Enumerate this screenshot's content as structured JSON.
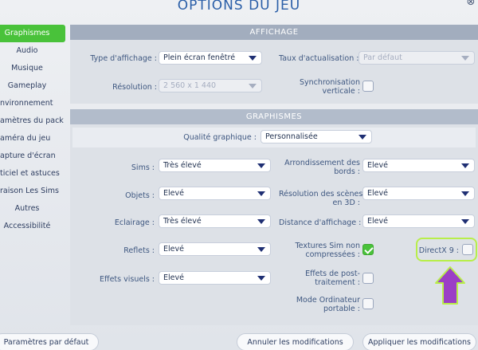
{
  "window": {
    "title": "OPTIONS DU JEU",
    "close_symbol": "⊗"
  },
  "sidebar": {
    "items": [
      {
        "label": "Graphismes",
        "active": true
      },
      {
        "label": "Audio"
      },
      {
        "label": "Musique"
      },
      {
        "label": "Gameplay"
      },
      {
        "label": "nvironnement"
      },
      {
        "label": "amètres du pack"
      },
      {
        "label": "améra du jeu"
      },
      {
        "label": "apture d'écran"
      },
      {
        "label": "ticiel et astuces"
      },
      {
        "label": "raison Les Sims"
      },
      {
        "label": "Autres"
      },
      {
        "label": "Accessibilité"
      }
    ]
  },
  "affichage": {
    "header": "AFFICHAGE",
    "type_label": "Type d'affichage :",
    "type_value": "Plein écran fenêtré",
    "taux_label": "Taux d'actualisation :",
    "taux_value": "Par défaut",
    "resolution_label": "Résolution :",
    "resolution_value": "2 560 x 1 440",
    "sync_label_1": "Synchronisation",
    "sync_label_2": "verticale :"
  },
  "graphismes": {
    "header": "GRAPHISMES",
    "qualite_label": "Qualité graphique :",
    "qualite_value": "Personnalisée",
    "sims_label": "Sims :",
    "sims_value": "Très élevé",
    "arrondi_label_1": "Arrondissement des",
    "arrondi_label_2": "bords :",
    "arrondi_value": "Elevé",
    "objets_label": "Objets :",
    "objets_value": "Elevé",
    "res_scenes_label_1": "Résolution des scènes",
    "res_scenes_label_2": "en 3D :",
    "res_scenes_value": "Elevé",
    "eclairage_label": "Eclairage :",
    "eclairage_value": "Très élevé",
    "distance_label": "Distance d'affichage :",
    "distance_value": "Elevé",
    "reflets_label": "Reflets :",
    "reflets_value": "Elevé",
    "textures_label_1": "Textures Sim non",
    "textures_label_2": "compressées :",
    "textures_checked": true,
    "directx_label": "DirectX 9 :",
    "effets_label": "Effets visuels :",
    "effets_value": "Elevé",
    "post_label_1": "Effets de post-",
    "post_label_2": "traitement :",
    "mode_label_1": "Mode Ordinateur",
    "mode_label_2": "portable :"
  },
  "footer": {
    "defaults_button": "Paramètres par défaut",
    "cancel_button": "Annuler les modifications",
    "apply_button": "Appliquer les modifications"
  },
  "colors": {
    "accent_green": "#49c23a",
    "highlight_green": "#b8ee4a",
    "arrow_purple": "#9b3fc6"
  }
}
